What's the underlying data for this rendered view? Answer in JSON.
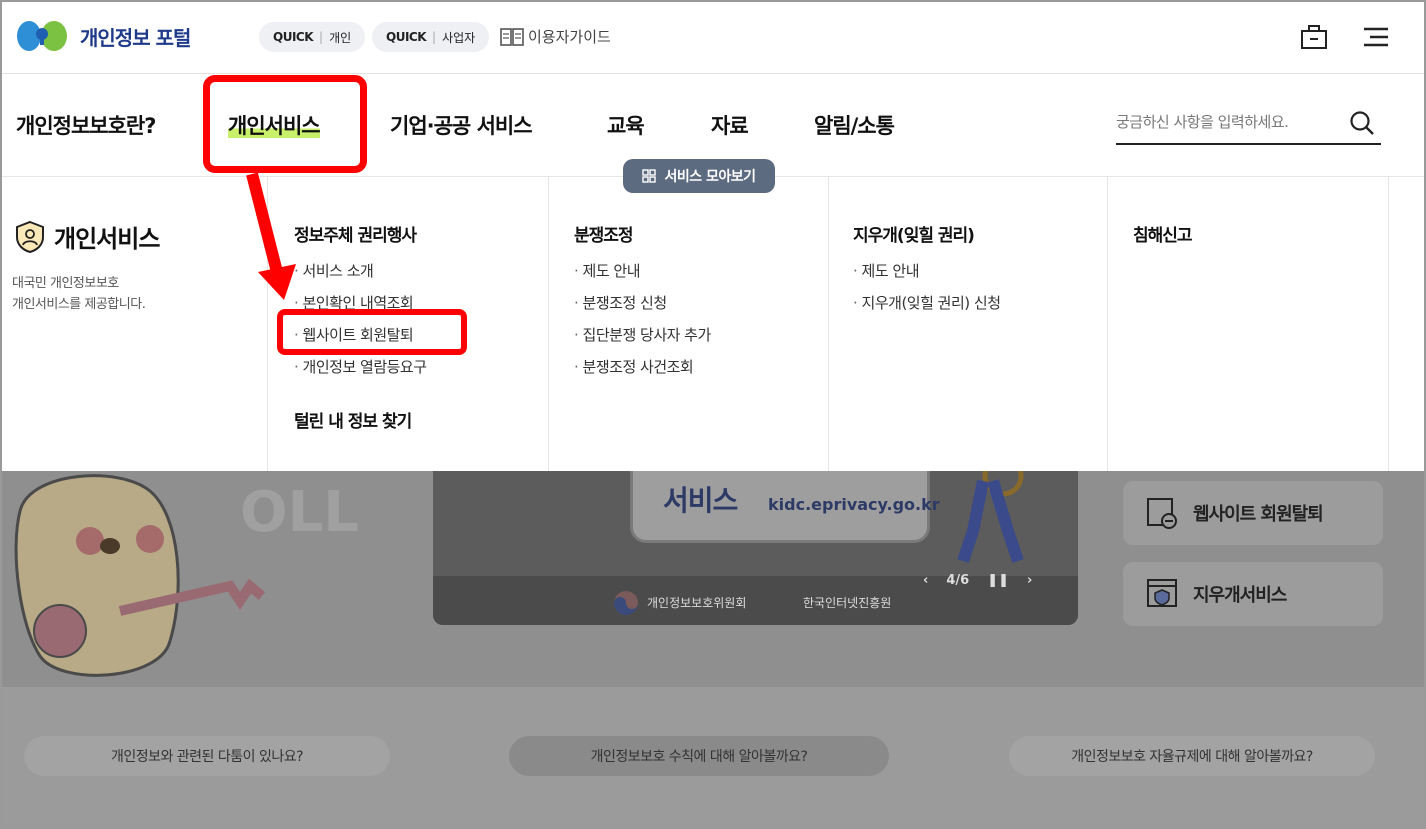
{
  "header": {
    "logo_text": "개인정보 포털",
    "quick_personal": {
      "prefix": "QUICK",
      "label": "개인"
    },
    "quick_business": {
      "prefix": "QUICK",
      "label": "사업자"
    },
    "guide_label": "이용자가이드"
  },
  "nav": {
    "items": [
      {
        "label": "개인정보보호란?"
      },
      {
        "label": "개인서비스"
      },
      {
        "label": "기업·공공 서비스"
      },
      {
        "label": "교육"
      },
      {
        "label": "자료"
      },
      {
        "label": "알림/소통"
      }
    ],
    "active_index": 1,
    "search_placeholder": "궁금하신 사항을 입력하세요.",
    "collect_label": "서비스 모아보기"
  },
  "mega": {
    "title": "개인서비스",
    "desc_line1": "대국민 개인정보보호",
    "desc_line2": "개인서비스를 제공합니다.",
    "columns": [
      {
        "heading": "정보주체 권리행사",
        "links": [
          "서비스 소개",
          "본인확인 내역조회",
          "웹사이트 회원탈퇴",
          "개인정보 열람등요구"
        ],
        "heading2": "털린 내 정보 찾기"
      },
      {
        "heading": "분쟁조정",
        "links": [
          "제도 안내",
          "분쟁조정 신청",
          "집단분쟁 당사자 추가",
          "분쟁조정 사건조회"
        ]
      },
      {
        "heading": "지우개(잊힐 권리)",
        "links": [
          "제도 안내",
          "지우개(잊힐 권리) 신청"
        ]
      },
      {
        "heading": "침해신고",
        "links": []
      }
    ]
  },
  "background": {
    "banner_line1": "서비스",
    "banner_url": "kidc.eprivacy.go.kr",
    "banner_page": "4/6",
    "org1": "개인정보보호위원회",
    "org2": "한국인터넷진흥원",
    "side_btn1": "웹사이트 회원탈퇴",
    "side_btn2": "지우개서비스",
    "pills": [
      "개인정보와 관련된 다툼이 있나요?",
      "개인정보보호 수칙에 대해 알아볼까요?",
      "개인정보보호 자율규제에 대해 알아볼까요?"
    ]
  },
  "colors": {
    "accent_underline": "#c8f06a",
    "annotation": "#ff0000",
    "logo_blue": "#1f3a8a"
  }
}
